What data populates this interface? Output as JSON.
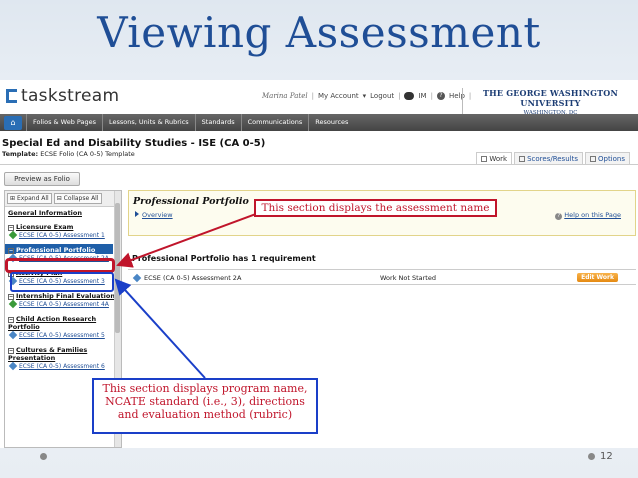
{
  "slide": {
    "title": "Viewing Assessment",
    "page_number": "12"
  },
  "app": {
    "logo": "taskstream",
    "user_name": "Marina Patel",
    "user_links": [
      "My Account",
      "Logout",
      "IM",
      "Help"
    ],
    "institution_line1": "THE GEORGE WASHINGTON UNIVERSITY",
    "institution_line2": "WASHINGTON, DC",
    "nav": [
      "Folios & Web Pages",
      "Lessons, Units & Rubrics",
      "Standards",
      "Communications",
      "Resources"
    ]
  },
  "page": {
    "title": "Special Ed and Disability Studies - ISE (CA 0-5)",
    "template_label": "Template:",
    "template_value": "ECSE Folio (CA 0-5) Template",
    "tabs": [
      "Work",
      "Scores/Results",
      "Options"
    ],
    "preview_button": "Preview as Folio"
  },
  "sidebar": {
    "expand_all": "Expand All",
    "collapse_all": "Collapse All",
    "general_information": "General Information",
    "sections": [
      {
        "title": "Licensure Exam",
        "items": [
          "ECSE (CA 0-5) Assessment 1"
        ]
      },
      {
        "title": "Professional Portfolio",
        "items": [
          "ECSE (CA 0-5) Assessment 2A"
        ]
      },
      {
        "title": "Activity Plan",
        "items": [
          "ECSE (CA 0-5) Assessment 3"
        ]
      },
      {
        "title": "Internship Final Evaluation",
        "items": [
          "ECSE (CA 0-5) Assessment 4A"
        ]
      },
      {
        "title": "Child Action Research Portfolio",
        "items": [
          "ECSE (CA 0-5) Assessment 5"
        ]
      },
      {
        "title": "Cultures & Families Presentation",
        "items": [
          "ECSE (CA 0-5) Assessment 6"
        ]
      }
    ]
  },
  "content": {
    "portfolio_name": "Professional Portfolio",
    "overview_link": "Overview",
    "help_link": "Help on this Page",
    "requirements_title": "Professional Portfolio has 1 requirement",
    "requirement": {
      "name": "ECSE (CA 0-5) Assessment 2A",
      "status": "Work Not Started",
      "action": "Edit Work"
    }
  },
  "callouts": {
    "assessment_name": "This section displays the assessment name",
    "program_details": "This section displays program name, NCATE standard (i.e., 3), directions and evaluation method (rubric)"
  },
  "colors": {
    "title_blue": "#1f4e96",
    "callout_red": "#c0152b",
    "callout_blue": "#1a3fc8",
    "edit_orange": "#e58a12"
  }
}
